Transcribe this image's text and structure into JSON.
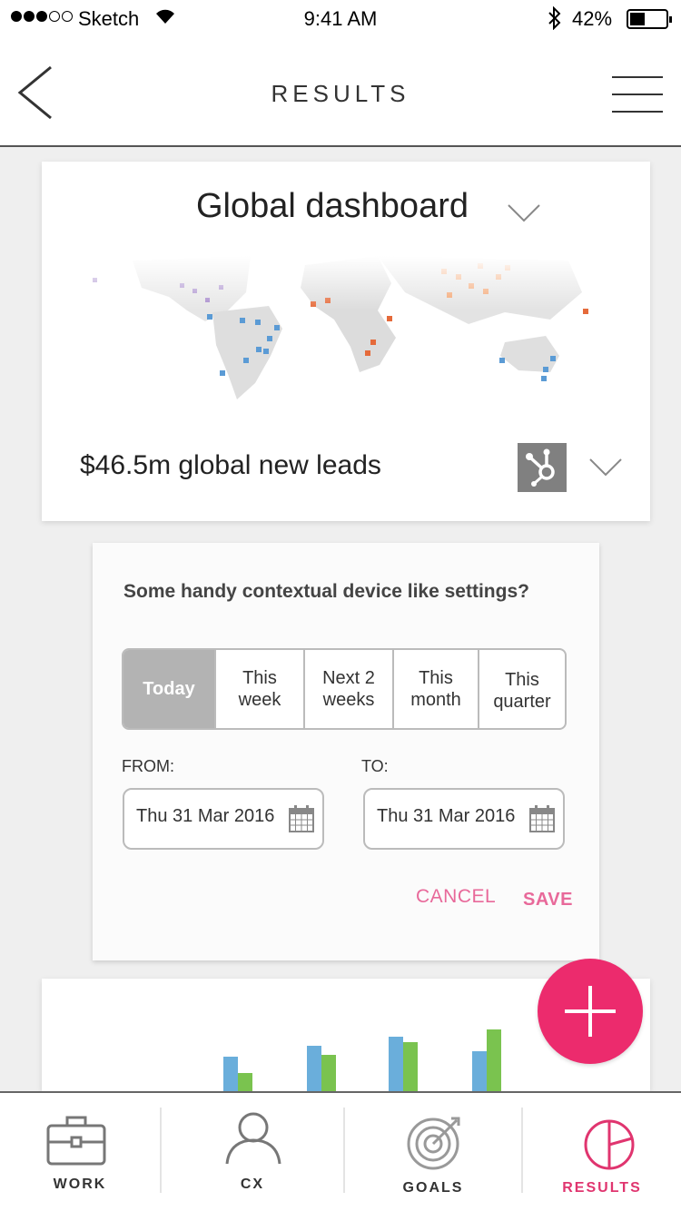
{
  "status_bar": {
    "carrier": "Sketch",
    "time": "9:41 AM",
    "battery": "42%"
  },
  "nav": {
    "title": "RESULTS"
  },
  "dashboard": {
    "title": "Global dashboard",
    "leads_label": "$46.5m global new leads"
  },
  "settings": {
    "question": "Some handy contextual device like settings?",
    "periods": [
      {
        "label": "Today"
      },
      {
        "label": "This\nweek"
      },
      {
        "label": "Next 2\nweeks"
      },
      {
        "label": "This\nmonth"
      },
      {
        "label": "This\nquarter"
      }
    ],
    "selected_period": "Today",
    "from_label": "FROM:",
    "to_label": "TO:",
    "from_value": "Thu 31 Mar 2016",
    "to_value": "Thu 31 Mar 2016",
    "cancel_label": "CANCEL",
    "save_label": "SAVE"
  },
  "chart_data": {
    "type": "bar",
    "series": [
      {
        "color": "#6aaedb",
        "values": [
          38,
          50,
          60,
          44
        ]
      },
      {
        "color": "#7ac34f",
        "values": [
          20,
          40,
          54,
          68
        ]
      }
    ]
  },
  "tabs": [
    {
      "label": "WORK",
      "icon": "briefcase-icon",
      "active": false
    },
    {
      "label": "CX",
      "icon": "person-icon",
      "active": false
    },
    {
      "label": "GOALS",
      "icon": "target-icon",
      "active": false
    },
    {
      "label": "RESULTS",
      "icon": "pie-chart-icon",
      "active": true
    }
  ],
  "colors": {
    "accent": "#ec2b6d",
    "accent_text": "#e8699a",
    "active_tab": "#e0356f"
  }
}
